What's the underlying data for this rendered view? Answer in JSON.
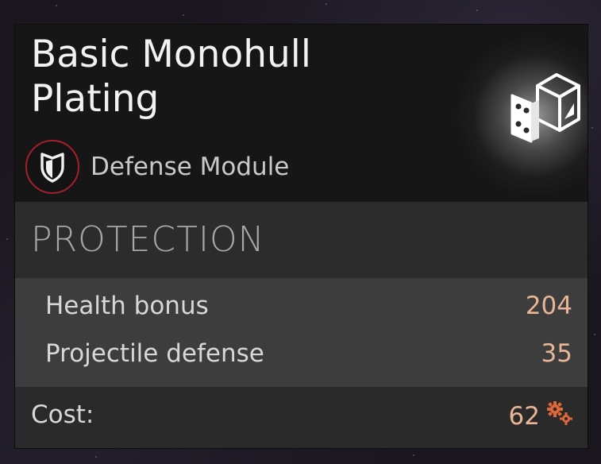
{
  "item": {
    "title": "Basic Monohull Plating",
    "category": "Defense Module",
    "category_icon": "shield-icon",
    "module_icon": "plating-cube-icon"
  },
  "section": {
    "title": "PROTECTION"
  },
  "stats": [
    {
      "label": "Health bonus",
      "value": "204"
    },
    {
      "label": "Projectile defense",
      "value": "35"
    }
  ],
  "cost": {
    "label": "Cost:",
    "value": "62",
    "icon": "gears-icon"
  },
  "colors": {
    "accent_red": "#a3202c",
    "value_peach": "#e8b596",
    "cost_icon": "#e0683a"
  }
}
